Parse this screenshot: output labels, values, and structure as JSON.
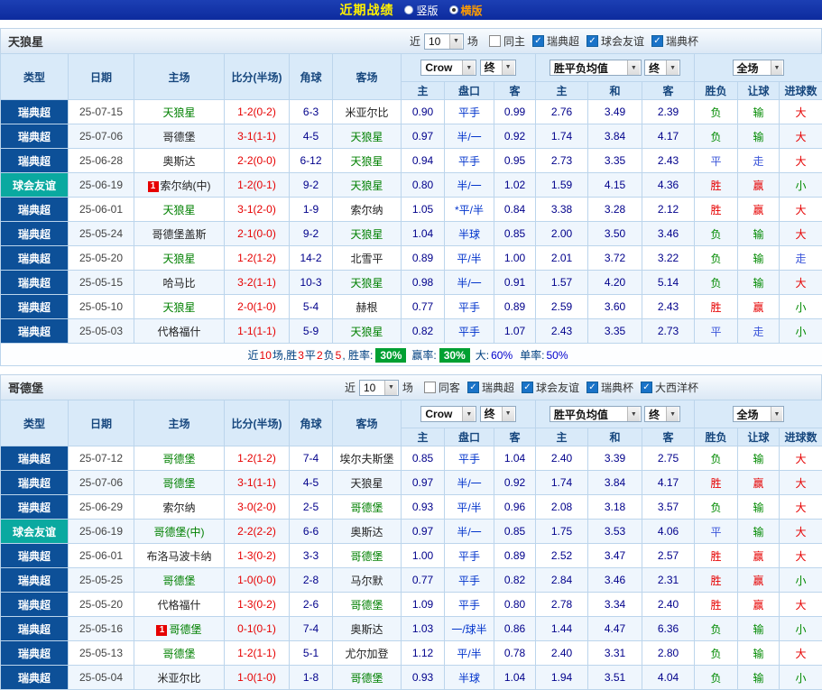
{
  "topbar": {
    "title": "近期战绩",
    "vertical": "竖版",
    "horizontal": "横版"
  },
  "filters": {
    "near": "近",
    "count": "10",
    "games": "场"
  },
  "table_columns": [
    "类型",
    "日期",
    "主场",
    "比分(半场)",
    "角球",
    "客场"
  ],
  "table_subcolumns": [
    "主",
    "盘口",
    "客",
    "主",
    "和",
    "客",
    "胜负",
    "让球",
    "进球数"
  ],
  "table_dropdowns": {
    "source": "Crow",
    "source_time": "终",
    "europe": "胜平负均值",
    "europe_time": "终",
    "scope": "全场"
  },
  "sections": [
    {
      "team": "天狼星",
      "checkboxes": [
        {
          "label": "同主",
          "checked": false
        },
        {
          "label": "瑞典超",
          "checked": true
        },
        {
          "label": "球会友谊",
          "checked": true
        },
        {
          "label": "瑞典杯",
          "checked": true
        }
      ],
      "rows": [
        {
          "league": "瑞典超",
          "lg": "super",
          "date": "25-07-15",
          "badge": "",
          "home": "天狼星",
          "home_c": "sub",
          "score": "1-2(0-2)",
          "corner": "6-3",
          "away": "米亚尔比",
          "away_c": "",
          "a1": "0.90",
          "line": "平手",
          "a2": "0.99",
          "e1": "2.76",
          "e2": "3.49",
          "e3": "2.39",
          "r1": "负",
          "c1": "g",
          "r2": "输",
          "c2": "g",
          "r3": "大",
          "c3": "r"
        },
        {
          "league": "瑞典超",
          "lg": "super",
          "date": "25-07-06",
          "badge": "",
          "home": "哥德堡",
          "home_c": "",
          "score": "3-1(1-1)",
          "corner": "4-5",
          "away": "天狼星",
          "away_c": "sub",
          "a1": "0.97",
          "line": "半/一",
          "a2": "0.92",
          "e1": "1.74",
          "e2": "3.84",
          "e3": "4.17",
          "r1": "负",
          "c1": "g",
          "r2": "输",
          "c2": "g",
          "r3": "大",
          "c3": "r"
        },
        {
          "league": "瑞典超",
          "lg": "super",
          "date": "25-06-28",
          "badge": "",
          "home": "奥斯达",
          "home_c": "",
          "score": "2-2(0-0)",
          "corner": "6-12",
          "away": "天狼星",
          "away_c": "sub",
          "a1": "0.94",
          "line": "平手",
          "a2": "0.95",
          "e1": "2.73",
          "e2": "3.35",
          "e3": "2.43",
          "r1": "平",
          "c1": "b",
          "r2": "走",
          "c2": "b",
          "r3": "大",
          "c3": "r"
        },
        {
          "league": "球会友谊",
          "lg": "friend",
          "date": "25-06-19",
          "badge": "1",
          "home": "索尔纳(中)",
          "home_c": "",
          "score": "1-2(0-1)",
          "corner": "9-2",
          "away": "天狼星",
          "away_c": "sub",
          "a1": "0.80",
          "line": "半/一",
          "a2": "1.02",
          "e1": "1.59",
          "e2": "4.15",
          "e3": "4.36",
          "r1": "胜",
          "c1": "r",
          "r2": "赢",
          "c2": "r",
          "r3": "小",
          "c3": "g"
        },
        {
          "league": "瑞典超",
          "lg": "super",
          "date": "25-06-01",
          "badge": "",
          "home": "天狼星",
          "home_c": "sub",
          "score": "3-1(2-0)",
          "corner": "1-9",
          "away": "索尔纳",
          "away_c": "",
          "a1": "1.05",
          "line": "*平/半",
          "a2": "0.84",
          "e1": "3.38",
          "e2": "3.28",
          "e3": "2.12",
          "r1": "胜",
          "c1": "r",
          "r2": "赢",
          "c2": "r",
          "r3": "大",
          "c3": "r"
        },
        {
          "league": "瑞典超",
          "lg": "super",
          "date": "25-05-24",
          "badge": "",
          "home": "哥德堡盖斯",
          "home_c": "",
          "score": "2-1(0-0)",
          "corner": "9-2",
          "away": "天狼星",
          "away_c": "sub",
          "a1": "1.04",
          "line": "半球",
          "a2": "0.85",
          "e1": "2.00",
          "e2": "3.50",
          "e3": "3.46",
          "r1": "负",
          "c1": "g",
          "r2": "输",
          "c2": "g",
          "r3": "大",
          "c3": "r"
        },
        {
          "league": "瑞典超",
          "lg": "super",
          "date": "25-05-20",
          "badge": "",
          "home": "天狼星",
          "home_c": "sub",
          "score": "1-2(1-2)",
          "corner": "14-2",
          "away": "北雪平",
          "away_c": "",
          "a1": "0.89",
          "line": "平/半",
          "a2": "1.00",
          "e1": "2.01",
          "e2": "3.72",
          "e3": "3.22",
          "r1": "负",
          "c1": "g",
          "r2": "输",
          "c2": "g",
          "r3": "走",
          "c3": "b"
        },
        {
          "league": "瑞典超",
          "lg": "super",
          "date": "25-05-15",
          "badge": "",
          "home": "哈马比",
          "home_c": "",
          "score": "3-2(1-1)",
          "corner": "10-3",
          "away": "天狼星",
          "away_c": "sub",
          "a1": "0.98",
          "line": "半/一",
          "a2": "0.91",
          "e1": "1.57",
          "e2": "4.20",
          "e3": "5.14",
          "r1": "负",
          "c1": "g",
          "r2": "输",
          "c2": "g",
          "r3": "大",
          "c3": "r"
        },
        {
          "league": "瑞典超",
          "lg": "super",
          "date": "25-05-10",
          "badge": "",
          "home": "天狼星",
          "home_c": "sub",
          "score": "2-0(1-0)",
          "corner": "5-4",
          "away": "赫根",
          "away_c": "",
          "a1": "0.77",
          "line": "平手",
          "a2": "0.89",
          "e1": "2.59",
          "e2": "3.60",
          "e3": "2.43",
          "r1": "胜",
          "c1": "r",
          "r2": "赢",
          "c2": "r",
          "r3": "小",
          "c3": "g"
        },
        {
          "league": "瑞典超",
          "lg": "super",
          "date": "25-05-03",
          "badge": "",
          "home": "代格福什",
          "home_c": "",
          "score": "1-1(1-1)",
          "corner": "5-9",
          "away": "天狼星",
          "away_c": "sub",
          "a1": "0.82",
          "line": "平手",
          "a2": "1.07",
          "e1": "2.43",
          "e2": "3.35",
          "e3": "2.73",
          "r1": "平",
          "c1": "b",
          "r2": "走",
          "c2": "b",
          "r3": "小",
          "c3": "g"
        }
      ],
      "summary": {
        "s1": "近",
        "n1": "10",
        "s2": "场,胜",
        "n2": "3",
        "s3": "平",
        "n3": "2",
        "s4": "负",
        "n4": "5",
        "s5": ", 胜率:",
        "b1": "30%",
        "s6": "赢率:",
        "b2": "30%",
        "s7": "大:",
        "v1": "60%",
        "s8": "单率:",
        "v2": "50%"
      }
    },
    {
      "team": "哥德堡",
      "checkboxes": [
        {
          "label": "同客",
          "checked": false
        },
        {
          "label": "瑞典超",
          "checked": true
        },
        {
          "label": "球会友谊",
          "checked": true
        },
        {
          "label": "瑞典杯",
          "checked": true
        },
        {
          "label": "大西洋杯",
          "checked": true
        }
      ],
      "rows": [
        {
          "league": "瑞典超",
          "lg": "super",
          "date": "25-07-12",
          "badge": "",
          "home": "哥德堡",
          "home_c": "sub",
          "score": "1-2(1-2)",
          "corner": "7-4",
          "away": "埃尔夫斯堡",
          "away_c": "",
          "a1": "0.85",
          "line": "平手",
          "a2": "1.04",
          "e1": "2.40",
          "e2": "3.39",
          "e3": "2.75",
          "r1": "负",
          "c1": "g",
          "r2": "输",
          "c2": "g",
          "r3": "大",
          "c3": "r"
        },
        {
          "league": "瑞典超",
          "lg": "super",
          "date": "25-07-06",
          "badge": "",
          "home": "哥德堡",
          "home_c": "sub",
          "score": "3-1(1-1)",
          "corner": "4-5",
          "away": "天狼星",
          "away_c": "",
          "a1": "0.97",
          "line": "半/一",
          "a2": "0.92",
          "e1": "1.74",
          "e2": "3.84",
          "e3": "4.17",
          "r1": "胜",
          "c1": "r",
          "r2": "赢",
          "c2": "r",
          "r3": "大",
          "c3": "r"
        },
        {
          "league": "瑞典超",
          "lg": "super",
          "date": "25-06-29",
          "badge": "",
          "home": "索尔纳",
          "home_c": "",
          "score": "3-0(2-0)",
          "corner": "2-5",
          "away": "哥德堡",
          "away_c": "sub",
          "a1": "0.93",
          "line": "平/半",
          "a2": "0.96",
          "e1": "2.08",
          "e2": "3.18",
          "e3": "3.57",
          "r1": "负",
          "c1": "g",
          "r2": "输",
          "c2": "g",
          "r3": "大",
          "c3": "r"
        },
        {
          "league": "球会友谊",
          "lg": "friend",
          "date": "25-06-19",
          "badge": "",
          "home": "哥德堡(中)",
          "home_c": "sub",
          "score": "2-2(2-2)",
          "corner": "6-6",
          "away": "奥斯达",
          "away_c": "",
          "a1": "0.97",
          "line": "半/一",
          "a2": "0.85",
          "e1": "1.75",
          "e2": "3.53",
          "e3": "4.06",
          "r1": "平",
          "c1": "b",
          "r2": "输",
          "c2": "g",
          "r3": "大",
          "c3": "r"
        },
        {
          "league": "瑞典超",
          "lg": "super",
          "date": "25-06-01",
          "badge": "",
          "home": "布洛马波卡纳",
          "home_c": "",
          "score": "1-3(0-2)",
          "corner": "3-3",
          "away": "哥德堡",
          "away_c": "sub",
          "a1": "1.00",
          "line": "平手",
          "a2": "0.89",
          "e1": "2.52",
          "e2": "3.47",
          "e3": "2.57",
          "r1": "胜",
          "c1": "r",
          "r2": "赢",
          "c2": "r",
          "r3": "大",
          "c3": "r"
        },
        {
          "league": "瑞典超",
          "lg": "super",
          "date": "25-05-25",
          "badge": "",
          "home": "哥德堡",
          "home_c": "sub",
          "score": "1-0(0-0)",
          "corner": "2-8",
          "away": "马尔默",
          "away_c": "",
          "a1": "0.77",
          "line": "平手",
          "a2": "0.82",
          "e1": "2.84",
          "e2": "3.46",
          "e3": "2.31",
          "r1": "胜",
          "c1": "r",
          "r2": "赢",
          "c2": "r",
          "r3": "小",
          "c3": "g"
        },
        {
          "league": "瑞典超",
          "lg": "super",
          "date": "25-05-20",
          "badge": "",
          "home": "代格福什",
          "home_c": "",
          "score": "1-3(0-2)",
          "corner": "2-6",
          "away": "哥德堡",
          "away_c": "sub",
          "a1": "1.09",
          "line": "平手",
          "a2": "0.80",
          "e1": "2.78",
          "e2": "3.34",
          "e3": "2.40",
          "r1": "胜",
          "c1": "r",
          "r2": "赢",
          "c2": "r",
          "r3": "大",
          "c3": "r"
        },
        {
          "league": "瑞典超",
          "lg": "super",
          "date": "25-05-16",
          "badge": "1",
          "home": "哥德堡",
          "home_c": "sub",
          "score": "0-1(0-1)",
          "corner": "7-4",
          "away": "奥斯达",
          "away_c": "",
          "a1": "1.03",
          "line": "一/球半",
          "a2": "0.86",
          "e1": "1.44",
          "e2": "4.47",
          "e3": "6.36",
          "r1": "负",
          "c1": "g",
          "r2": "输",
          "c2": "g",
          "r3": "小",
          "c3": "g"
        },
        {
          "league": "瑞典超",
          "lg": "super",
          "date": "25-05-13",
          "badge": "",
          "home": "哥德堡",
          "home_c": "sub",
          "score": "1-2(1-1)",
          "corner": "5-1",
          "away": "尤尔加登",
          "away_c": "",
          "a1": "1.12",
          "line": "平/半",
          "a2": "0.78",
          "e1": "2.40",
          "e2": "3.31",
          "e3": "2.80",
          "r1": "负",
          "c1": "g",
          "r2": "输",
          "c2": "g",
          "r3": "大",
          "c3": "r"
        },
        {
          "league": "瑞典超",
          "lg": "super",
          "date": "25-05-04",
          "badge": "",
          "home": "米亚尔比",
          "home_c": "",
          "score": "1-0(1-0)",
          "corner": "1-8",
          "away": "哥德堡",
          "away_c": "sub",
          "a1": "0.93",
          "line": "半球",
          "a2": "1.04",
          "e1": "1.94",
          "e2": "3.51",
          "e3": "4.04",
          "r1": "负",
          "c1": "g",
          "r2": "输",
          "c2": "g",
          "r3": "小",
          "c3": "g"
        }
      ]
    }
  ]
}
